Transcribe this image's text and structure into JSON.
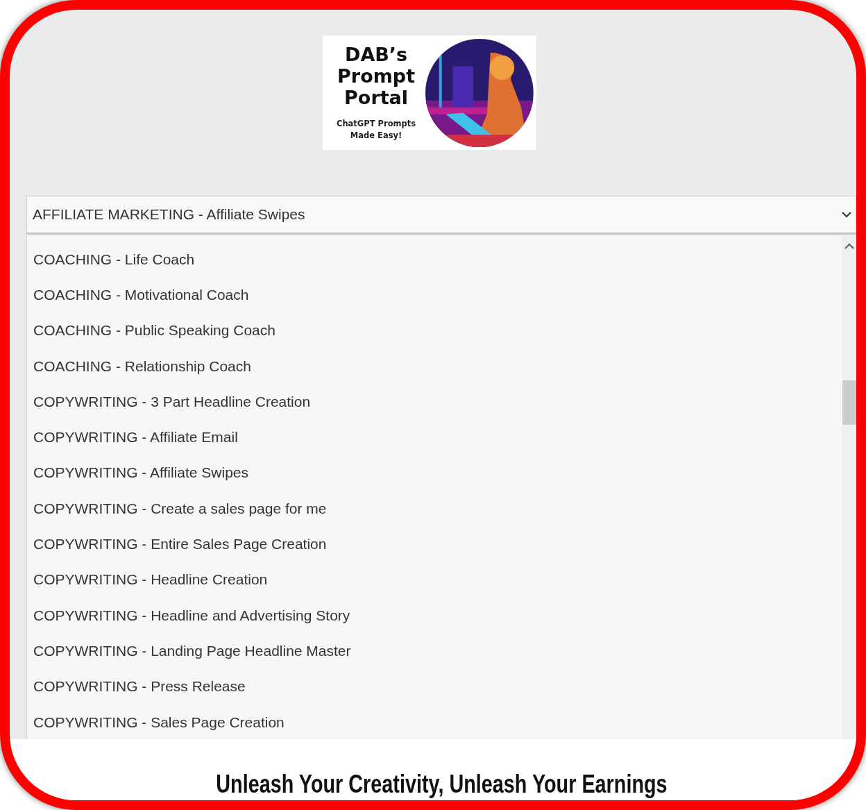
{
  "logo": {
    "title_lines": [
      "DAB’s",
      "Prompt",
      "Portal"
    ],
    "tagline_lines": [
      "ChatGPT Prompts",
      "Made Easy!"
    ],
    "image": {
      "kind": "picture"
    }
  },
  "select": {
    "value": "AFFILIATE MARKETING - Affiliate Swipes"
  },
  "options": [
    {
      "label": "COACHING - Life Coach"
    },
    {
      "label": "COACHING - Motivational Coach"
    },
    {
      "label": "COACHING - Public Speaking Coach"
    },
    {
      "label": "COACHING - Relationship Coach"
    },
    {
      "label": "COPYWRITING - 3 Part Headline Creation"
    },
    {
      "label": "COPYWRITING - Affiliate Email"
    },
    {
      "label": "COPYWRITING - Affiliate Swipes"
    },
    {
      "label": "COPYWRITING - Create a sales page for me"
    },
    {
      "label": "COPYWRITING - Entire Sales Page Creation"
    },
    {
      "label": "COPYWRITING - Headline Creation"
    },
    {
      "label": "COPYWRITING - Headline and Advertising Story"
    },
    {
      "label": "COPYWRITING - Landing Page Headline Master"
    },
    {
      "label": "COPYWRITING - Press Release"
    },
    {
      "label": "COPYWRITING - Sales Page Creation"
    }
  ],
  "slogan": "Unleash Your Creativity, Unleash Your Earnings"
}
